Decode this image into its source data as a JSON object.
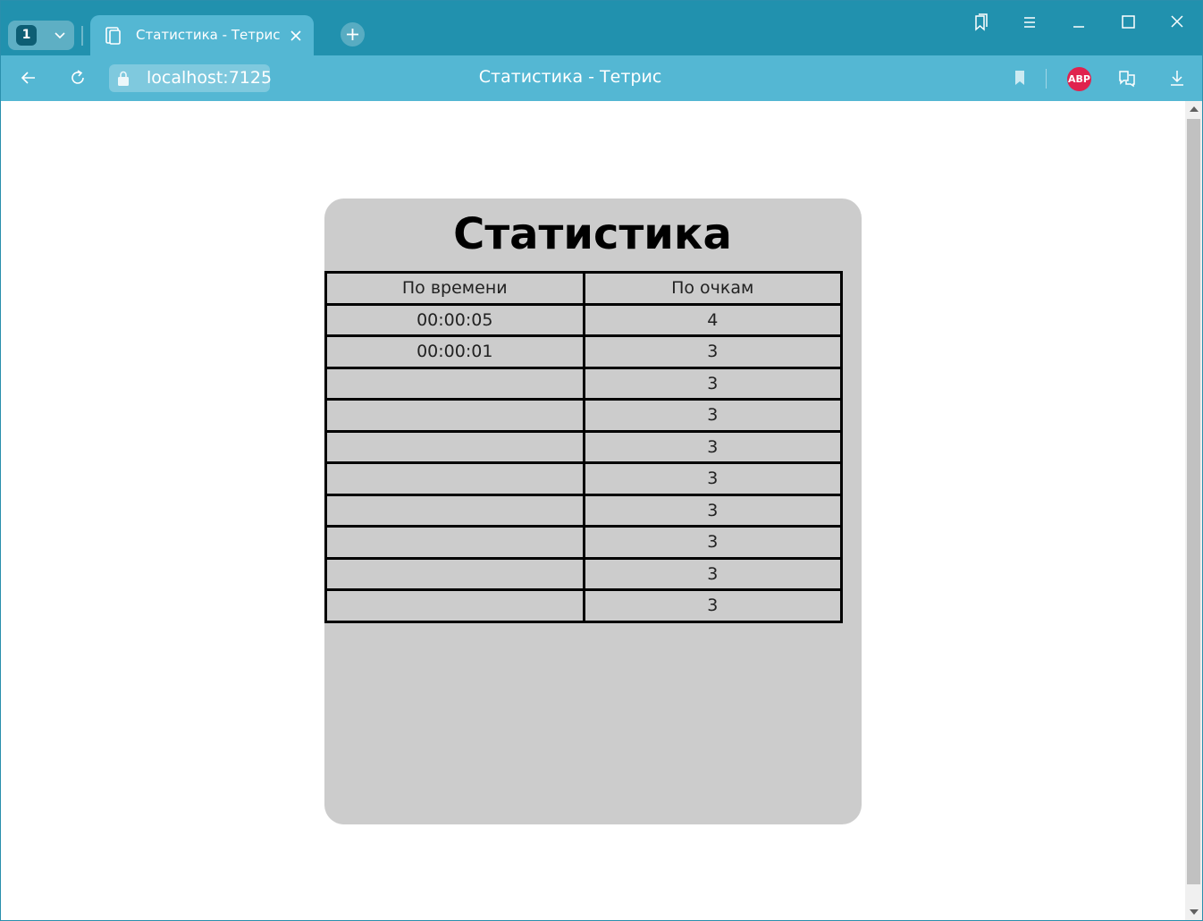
{
  "browser": {
    "tab_count": "1",
    "tab_title": "Статистика - Тетрис",
    "url": "localhost:7125",
    "page_title": "Статистика - Тетрис",
    "adblock_label": "ABP",
    "accent_color": "#2191ae",
    "toolbar_color": "#54b7d3"
  },
  "page": {
    "heading": "Статистика",
    "table": {
      "headers": [
        "По времени",
        "По очкам"
      ],
      "rows": [
        [
          "00:00:05",
          "4"
        ],
        [
          "00:00:01",
          "3"
        ],
        [
          "",
          "3"
        ],
        [
          "",
          "3"
        ],
        [
          "",
          "3"
        ],
        [
          "",
          "3"
        ],
        [
          "",
          "3"
        ],
        [
          "",
          "3"
        ],
        [
          "",
          "3"
        ],
        [
          "",
          "3"
        ]
      ]
    },
    "panel_color": "#cccccc"
  }
}
